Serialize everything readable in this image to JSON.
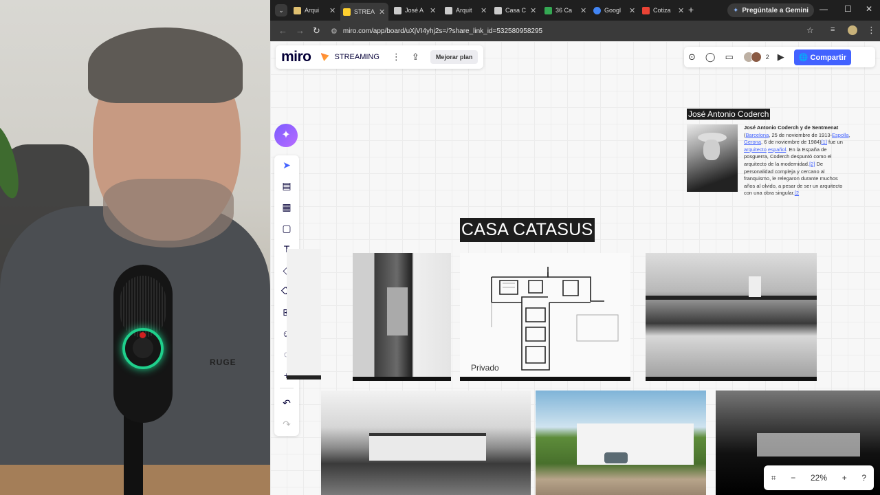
{
  "browser": {
    "tabs": [
      {
        "label": "Arqui",
        "color": "#e0c070",
        "active": false
      },
      {
        "label": "STREA",
        "color": "#ffd02f",
        "active": true
      },
      {
        "label": "José A",
        "color": "#cccccc",
        "active": false
      },
      {
        "label": "Arquit",
        "color": "#cccccc",
        "active": false
      },
      {
        "label": "Casa C",
        "color": "#cccccc",
        "active": false
      },
      {
        "label": "36 Ca",
        "color": "#34a853",
        "active": false
      },
      {
        "label": "Googl",
        "color": "#4285f4",
        "active": false
      },
      {
        "label": "Cotiza",
        "color": "#ea4335",
        "active": false
      }
    ],
    "gemini_label": "Pregúntale a Gemini",
    "url": "miro.com/app/board/uXjVI4yhj2s=/?share_link_id=532580958295"
  },
  "miro": {
    "logo": "miro",
    "board_name": "STREAMING",
    "upgrade_label": "Mejorar plan",
    "collaborator_count": "2",
    "share_label": "Compartir",
    "zoom_level": "22%"
  },
  "board": {
    "architect_heading": "José Antonio Coderch",
    "architect_name_bold": "José Antonio Coderch y de Sentmenat",
    "architect_bio_1": " (",
    "link_barcelona": "Barcelona",
    "architect_bio_2": ", 25 de noviembre de 1913-",
    "link_espolla": "Espolla",
    "sep1": ", ",
    "link_gerona": "Gerona",
    "architect_bio_3": ", 6 de noviembre de 1984)",
    "ref1": "[1]",
    "architect_bio_4": " fue un ",
    "link_arquitecto": "arquitecto",
    "sep2": " ",
    "link_espanol": "español",
    "architect_bio_5": ". En la España de posguerra, Coderch despuntó como el arquitecto de la modernidad.",
    "ref2": "[2]",
    "architect_bio_6": " De personalidad compleja y cercano al franquismo, le relegaron durante muchos años al olvido, a pesar de ser un arquitecto con una obra singular.",
    "ref3": "[2",
    "casa_title": "CASA CATASUS",
    "plan_label": "Privado"
  }
}
